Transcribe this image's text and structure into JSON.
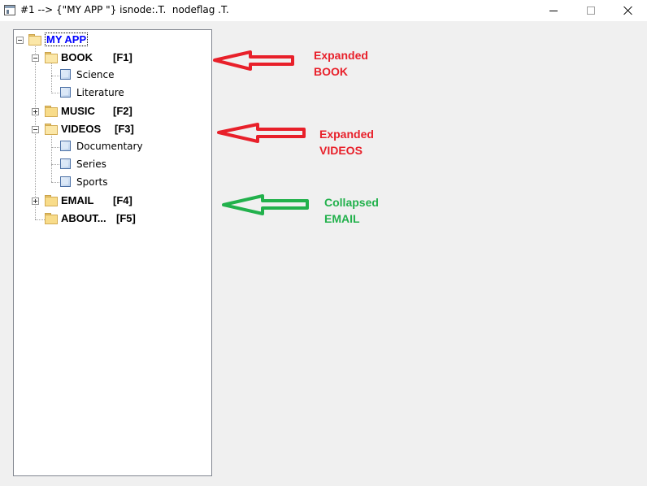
{
  "window": {
    "title": "#1 --> {\"MY APP \"} isnode:.T.  nodeflag .T.",
    "buttons": {
      "minimize": "minimize",
      "maximize": "maximize",
      "close": "close"
    }
  },
  "tree": {
    "root": {
      "label": "MY APP",
      "expanded": true
    },
    "nodes": [
      {
        "label": "BOOK",
        "key": "[F1]",
        "expanded": true,
        "children": [
          "Science",
          "Literature"
        ]
      },
      {
        "label": "MUSIC",
        "key": "[F2]",
        "expanded": false
      },
      {
        "label": "VIDEOS",
        "key": "[F3]",
        "expanded": true,
        "children": [
          "Documentary",
          "Series",
          "Sports"
        ]
      },
      {
        "label": "EMAIL",
        "key": "[F4]",
        "expanded": false
      },
      {
        "label": "ABOUT...",
        "key": "[F5]",
        "expanded": false
      }
    ]
  },
  "annotations": [
    {
      "lines": [
        "Expanded",
        "BOOK"
      ],
      "color": "#e8202a"
    },
    {
      "lines": [
        "Expanded",
        "VIDEOS"
      ],
      "color": "#e8202a"
    },
    {
      "lines": [
        "Collapsed",
        "EMAIL"
      ],
      "color": "#22b14c"
    }
  ],
  "colors": {
    "red": "#e8202a",
    "green": "#22b14c",
    "root_label": "#0000ff"
  }
}
